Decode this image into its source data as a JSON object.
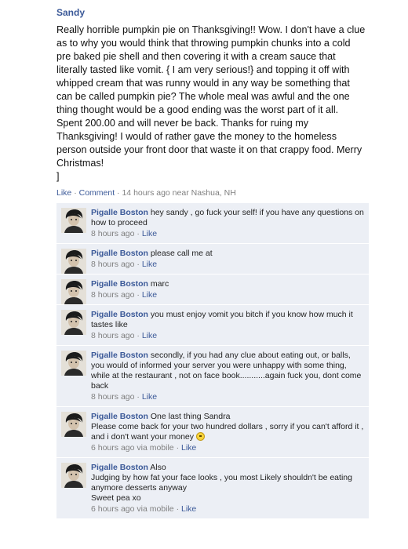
{
  "post": {
    "author": "Sandy",
    "message": "Really horrible pumpkin pie on Thanksgiving!! Wow. I don't have a clue as to why you would think that throwing pumpkin chunks into a cold pre baked pie shell and then covering it with a cream sauce that literally tasted like vomit. { I am very serious!} and topping it off with whipped cream that was runny would in any way be something that can be called pumpkin pie? The whole meal was awful and the one thing thought would be a good ending was the worst part of it all. Spent 200.00 and will never be back. Thanks for ruing my Thanksgiving! I would of rather gave the money to the homeless person outside your front door that waste it on that crappy food. Merry Christmas!\n]",
    "like_label": "Like",
    "separator": "·",
    "comment_label": "Comment",
    "timestamp": "14 hours ago near Nashua, NH"
  },
  "comments": [
    {
      "author": "Pigalle Boston",
      "text": "hey sandy , go fuck your self! if you have any questions on how to proceed",
      "time": "8 hours ago",
      "like_label": "Like"
    },
    {
      "author": "Pigalle Boston",
      "text": "please call me at",
      "time": "8 hours ago",
      "like_label": "Like"
    },
    {
      "author": "Pigalle Boston",
      "text": "marc",
      "time": "8 hours ago",
      "like_label": "Like"
    },
    {
      "author": "Pigalle Boston",
      "text": "you must enjoy vomit you bitch if you know how much it tastes like",
      "time": "8 hours ago",
      "like_label": "Like"
    },
    {
      "author": "Pigalle Boston",
      "text": "secondly, if you had any clue about eating out, or balls, you would of informed your server you were unhappy with some thing, while at the restaurant , not on face book...........again fuck you, dont come back",
      "time": "8 hours ago",
      "like_label": "Like"
    },
    {
      "author": "Pigalle Boston",
      "text": "One last thing Sandra\nPlease come back for your two hundred dollars , sorry if you can't afford it , and i don't want your money",
      "emoticon": "smiley-icon",
      "time": "6 hours ago via mobile",
      "like_label": "Like"
    },
    {
      "author": "Pigalle Boston",
      "text": "Also\nJudging by how fat your face looks , you most Likely shouldn't be eating anymore desserts anyway\nSweet pea xo",
      "time": "6 hours ago via mobile",
      "like_label": "Like"
    }
  ],
  "colors": {
    "link": "#3b5998",
    "comment_bg": "#eceff5",
    "meta_gray": "#7f7f7f"
  }
}
